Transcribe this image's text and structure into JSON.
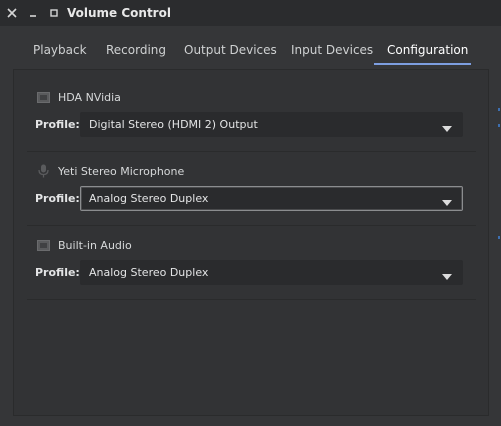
{
  "window": {
    "title": "Volume Control"
  },
  "tabs": [
    {
      "label": "Playback",
      "active": false
    },
    {
      "label": "Recording",
      "active": false
    },
    {
      "label": "Output Devices",
      "active": false
    },
    {
      "label": "Input Devices",
      "active": false
    },
    {
      "label": "Configuration",
      "active": true
    }
  ],
  "cards": [
    {
      "name": "HDA NVidia",
      "icon": "audio-card-icon",
      "profile_label": "Profile:",
      "profile_value": "Digital Stereo (HDMI 2) Output",
      "focused": false
    },
    {
      "name": "Yeti Stereo Microphone",
      "icon": "microphone-icon",
      "profile_label": "Profile:",
      "profile_value": "Analog Stereo Duplex",
      "focused": true
    },
    {
      "name": "Built-in Audio",
      "icon": "audio-card-icon",
      "profile_label": "Profile:",
      "profile_value": "Analog Stereo Duplex",
      "focused": false
    }
  ],
  "colors": {
    "accent": "#7d9ee0",
    "background": "#353638",
    "titlebar": "#2b2c2e",
    "combo_bg": "#2a2b2d"
  }
}
